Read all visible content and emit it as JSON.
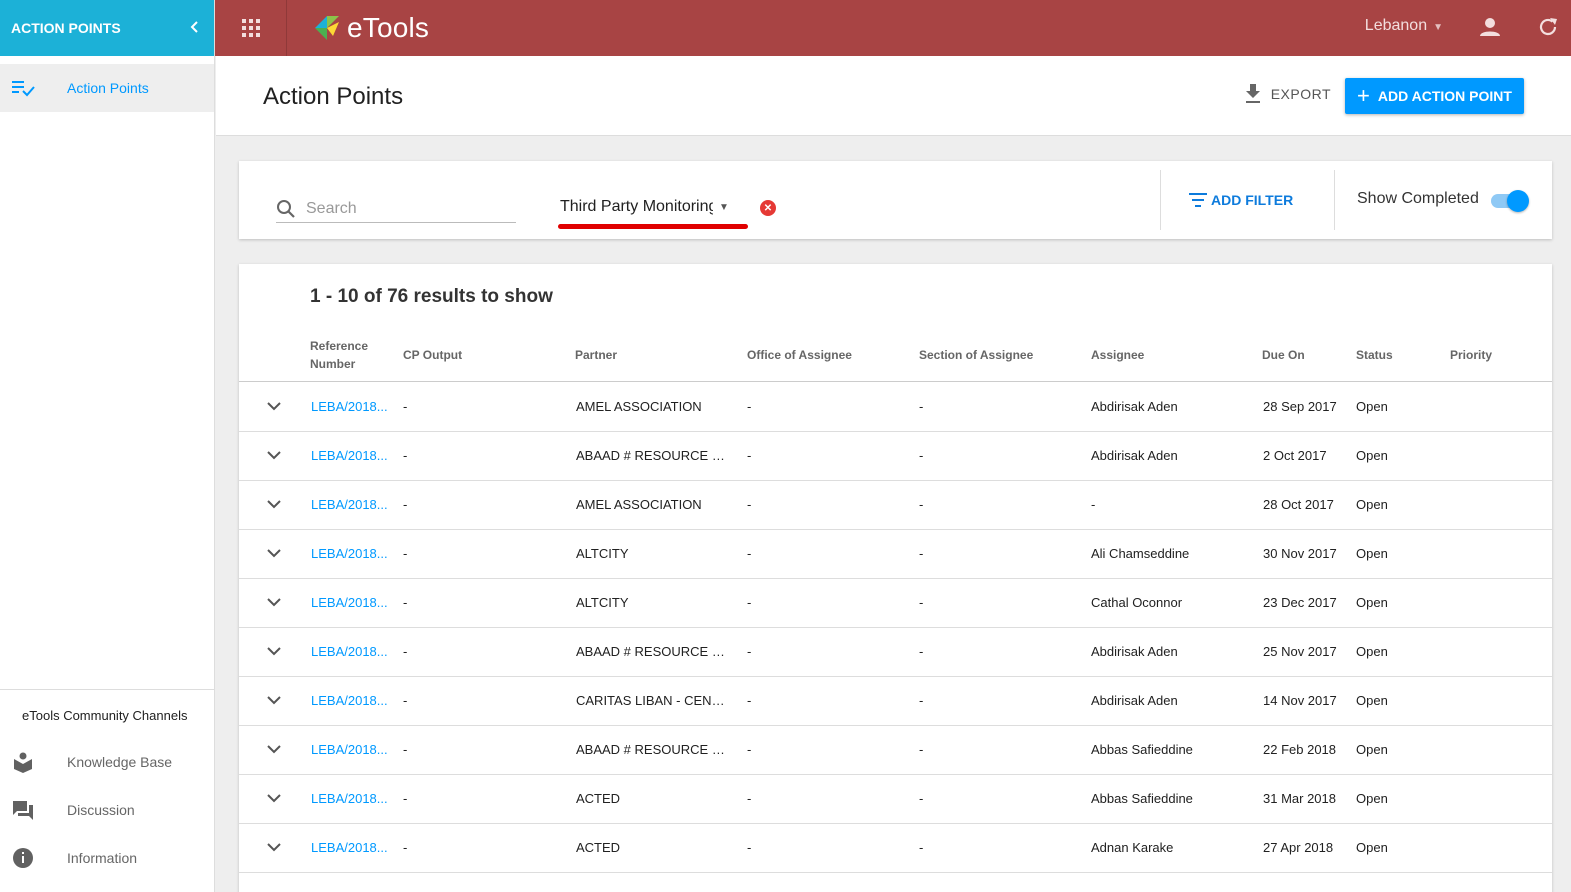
{
  "sidebar": {
    "header_title": "ACTION POINTS",
    "nav_item": "Action Points",
    "community_title": "eTools Community Channels",
    "community_items": [
      "Knowledge Base",
      "Discussion",
      "Information"
    ]
  },
  "topbar": {
    "logo_text": "eTools",
    "country": "Lebanon"
  },
  "header": {
    "title": "Action Points",
    "export_label": "EXPORT",
    "add_label": "ADD ACTION POINT"
  },
  "filters": {
    "search_placeholder": "Search",
    "selected_filter": "Third Party Monitoring",
    "add_filter_label": "ADD FILTER",
    "show_completed_label": "Show Completed",
    "show_completed": true
  },
  "results": {
    "count_text": "1 - 10 of 76 results to show",
    "columns": [
      "Reference Number",
      "CP Output",
      "Partner",
      "Office of Assignee",
      "Section of Assignee",
      "Assignee",
      "Due On",
      "Status",
      "Priority"
    ],
    "rows": [
      [
        "LEBA/2018...",
        "-",
        "AMEL ASSOCIATION",
        "-",
        "-",
        "Abdirisak Aden",
        "28 Sep 2017",
        "Open"
      ],
      [
        "LEBA/2018...",
        "-",
        "ABAAD # RESOURCE CE...",
        "-",
        "-",
        "Abdirisak Aden",
        "2 Oct 2017",
        "Open"
      ],
      [
        "LEBA/2018...",
        "-",
        "AMEL ASSOCIATION",
        "-",
        "-",
        "-",
        "28 Oct 2017",
        "Open"
      ],
      [
        "LEBA/2018...",
        "-",
        "ALTCITY",
        "-",
        "-",
        "Ali Chamseddine",
        "30 Nov 2017",
        "Open"
      ],
      [
        "LEBA/2018...",
        "-",
        "ALTCITY",
        "-",
        "-",
        "Cathal Oconnor",
        "23 Dec 2017",
        "Open"
      ],
      [
        "LEBA/2018...",
        "-",
        "ABAAD # RESOURCE CE...",
        "-",
        "-",
        "Abdirisak Aden",
        "25 Nov 2017",
        "Open"
      ],
      [
        "LEBA/2018...",
        "-",
        "CARITAS LIBAN - CENTR...",
        "-",
        "-",
        "Abdirisak Aden",
        "14 Nov 2017",
        "Open"
      ],
      [
        "LEBA/2018...",
        "-",
        "ABAAD # RESOURCE CE...",
        "-",
        "-",
        "Abbas Safieddine",
        "22 Feb 2018",
        "Open"
      ],
      [
        "LEBA/2018...",
        "-",
        "ACTED",
        "-",
        "-",
        "Abbas Safieddine",
        "31 Mar 2018",
        "Open"
      ],
      [
        "LEBA/2018...",
        "-",
        "ACTED",
        "-",
        "-",
        "Adnan Karake",
        "27 Apr 2018",
        "Open"
      ]
    ]
  },
  "colors": {
    "topbar": "#a84444",
    "sidebar_header": "#1cb1d7",
    "accent": "#0099ff",
    "highlight": "#e00000"
  }
}
